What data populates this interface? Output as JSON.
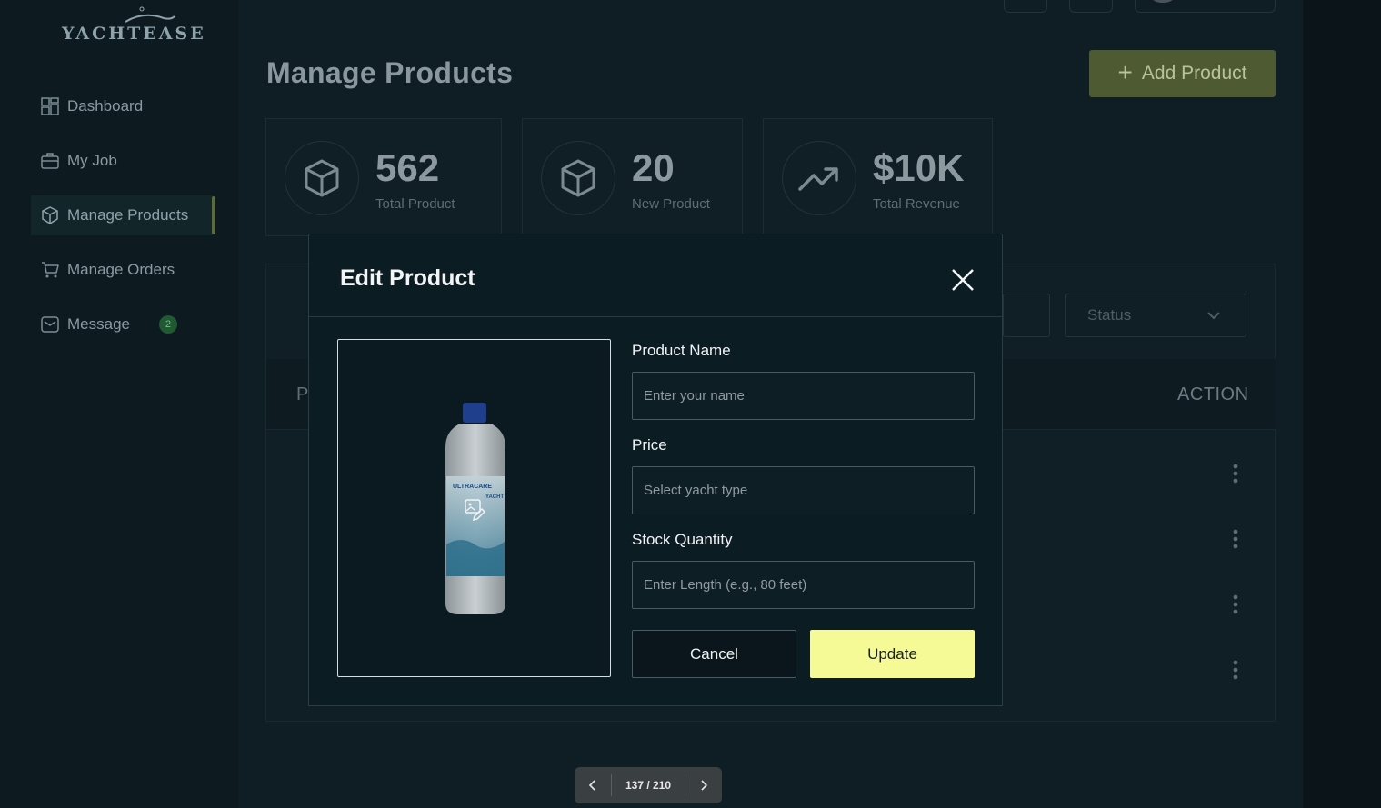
{
  "brand": {
    "name": "YACHTEASE",
    "tagline": ""
  },
  "sidebar": {
    "items": [
      {
        "label": "Dashboard",
        "icon": "dashboard-grid-icon"
      },
      {
        "label": "My Job",
        "icon": "briefcase-icon"
      },
      {
        "label": "Manage Products",
        "icon": "box-icon",
        "active": true
      },
      {
        "label": "Manage Orders",
        "icon": "cart-icon"
      },
      {
        "label": "Message",
        "icon": "mail-icon",
        "badge": "2"
      }
    ]
  },
  "header": {
    "title": "Manage Products",
    "add_button": "Add Product"
  },
  "stats": [
    {
      "value": "562",
      "label": "Total Product",
      "icon": "box-icon"
    },
    {
      "value": "20",
      "label": "New Product",
      "icon": "box-icon"
    },
    {
      "value": "$10K",
      "label": "Total Revenue",
      "icon": "trending-up-icon"
    }
  ],
  "table": {
    "status_placeholder": "Status",
    "header_left": "P",
    "header_action": "ACTION"
  },
  "modal": {
    "title": "Edit Product",
    "fields": {
      "product_name": {
        "label": "Product Name",
        "placeholder": "Enter your name"
      },
      "price": {
        "label": "Price",
        "placeholder": "Select yacht type"
      },
      "stock": {
        "label": "Stock Quantity",
        "placeholder": "Enter Length (e.g., 80 feet)"
      }
    },
    "cancel": "Cancel",
    "update": "Update",
    "product_image_text": {
      "brand": "ULTRACARE",
      "sub": "YACHT"
    }
  },
  "pager": {
    "text": "137 / 210"
  },
  "colors": {
    "accent_yellow": "#f6fa96",
    "add_button": "#4d5a32",
    "background": "#0f1e24"
  }
}
